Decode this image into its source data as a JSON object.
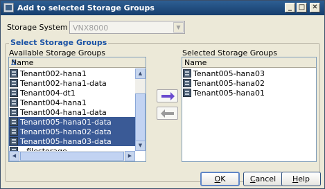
{
  "window": {
    "title": "Add to selected Storage Groups",
    "controls": {
      "minimize": "_",
      "maximize": "□",
      "close": "✕"
    }
  },
  "storage_system": {
    "label": "Storage System",
    "value": "VNX8000",
    "disabled": true
  },
  "group_title": "Select Storage Groups",
  "available": {
    "label": "Available Storage Groups",
    "header": "Name",
    "sort_indicator": "Δ",
    "items": [
      {
        "name": "Tenant002-hana1",
        "selected": false
      },
      {
        "name": "Tenant002-hana1-data",
        "selected": false
      },
      {
        "name": "Tenant004-dt1",
        "selected": false
      },
      {
        "name": "Tenant004-hana1",
        "selected": false
      },
      {
        "name": "Tenant004-hana1-data",
        "selected": false
      },
      {
        "name": "Tenant005-hana01-data",
        "selected": true
      },
      {
        "name": "Tenant005-hana02-data",
        "selected": true
      },
      {
        "name": "Tenant005-hana03-data",
        "selected": true
      },
      {
        "name": "~filestorage",
        "selected": false
      }
    ]
  },
  "selected": {
    "label": "Selected Storage Groups",
    "header": "Name",
    "items": [
      {
        "name": "Tenant005-hana03"
      },
      {
        "name": "Tenant005-hana02"
      },
      {
        "name": "Tenant005-hana01"
      }
    ]
  },
  "buttons": {
    "ok": {
      "first": "O",
      "rest": "K"
    },
    "cancel": {
      "first": "C",
      "rest": "ancel"
    },
    "help": {
      "first": "H",
      "rest": "elp"
    }
  },
  "colors": {
    "selection": "#3a5a96",
    "title_bar": "#1e4a7d",
    "group_title": "#1a52a4",
    "add_arrow": "#6a4bcf"
  },
  "icons": {
    "title": "window-app-icon",
    "row": "storage-group-icon",
    "add": "arrow-right-icon",
    "remove": "arrow-left-icon"
  }
}
